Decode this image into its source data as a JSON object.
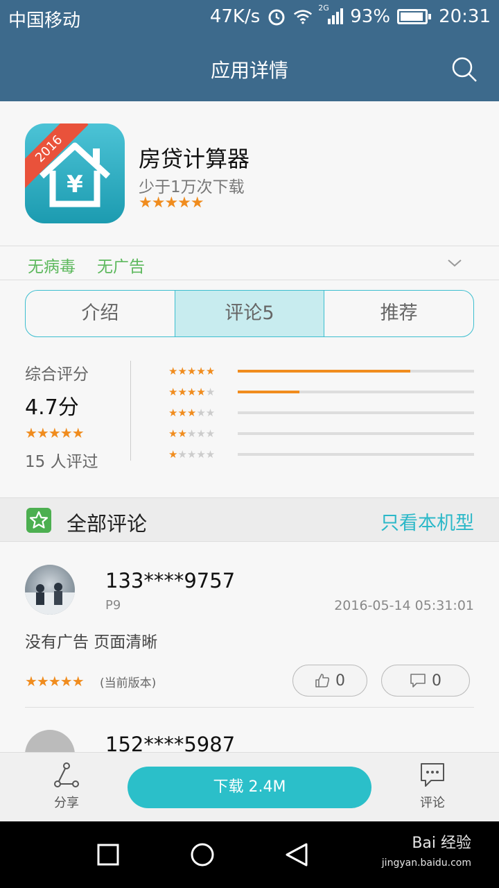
{
  "status_bar": {
    "carrier": "中国移动",
    "speed": "47K/s",
    "network": "2G",
    "battery": "93%",
    "battery_level": 0.93,
    "time": "20:31"
  },
  "header": {
    "title": "应用详情",
    "search_icon": "search-icon"
  },
  "app": {
    "name": "房贷计算器",
    "downloads": "少于1万次下载",
    "stars": "★★★★★",
    "icon_badge": "2016",
    "icon_glyph": "¥"
  },
  "tags": [
    "无病毒",
    "无广告"
  ],
  "tabs": [
    {
      "label": "介绍",
      "active": false
    },
    {
      "label": "评论5",
      "active": true
    },
    {
      "label": "推荐",
      "active": false
    }
  ],
  "rating": {
    "label": "综合评分",
    "score": "4.7分",
    "stars": "★★★★★",
    "count": "15 人评过",
    "distribution": [
      {
        "stars": 5,
        "fraction": 0.73
      },
      {
        "stars": 4,
        "fraction": 0.26
      },
      {
        "stars": 3,
        "fraction": 0
      },
      {
        "stars": 2,
        "fraction": 0
      },
      {
        "stars": 1,
        "fraction": 0
      }
    ]
  },
  "comments_section": {
    "title": "全部评论",
    "filter_link": "只看本机型"
  },
  "comments": [
    {
      "user": "133****9757",
      "device": "P9",
      "time": "2016-05-14 05:31:01",
      "text": "没有广告 页面清晰",
      "stars": "★★★★★",
      "version": "(当前版本)",
      "likes": "0",
      "replies": "0"
    },
    {
      "user": "152****5987"
    }
  ],
  "action_bar": {
    "share": "分享",
    "download": "下载 2.4M",
    "comment": "评论"
  },
  "watermark": {
    "brand": "Bai 经验",
    "url": "jingyan.baidu.com"
  },
  "colors": {
    "header_bg": "#3d6a8c",
    "accent": "#2bbfc9",
    "star": "#f08c1e",
    "tag_green": "#5cb85c"
  }
}
